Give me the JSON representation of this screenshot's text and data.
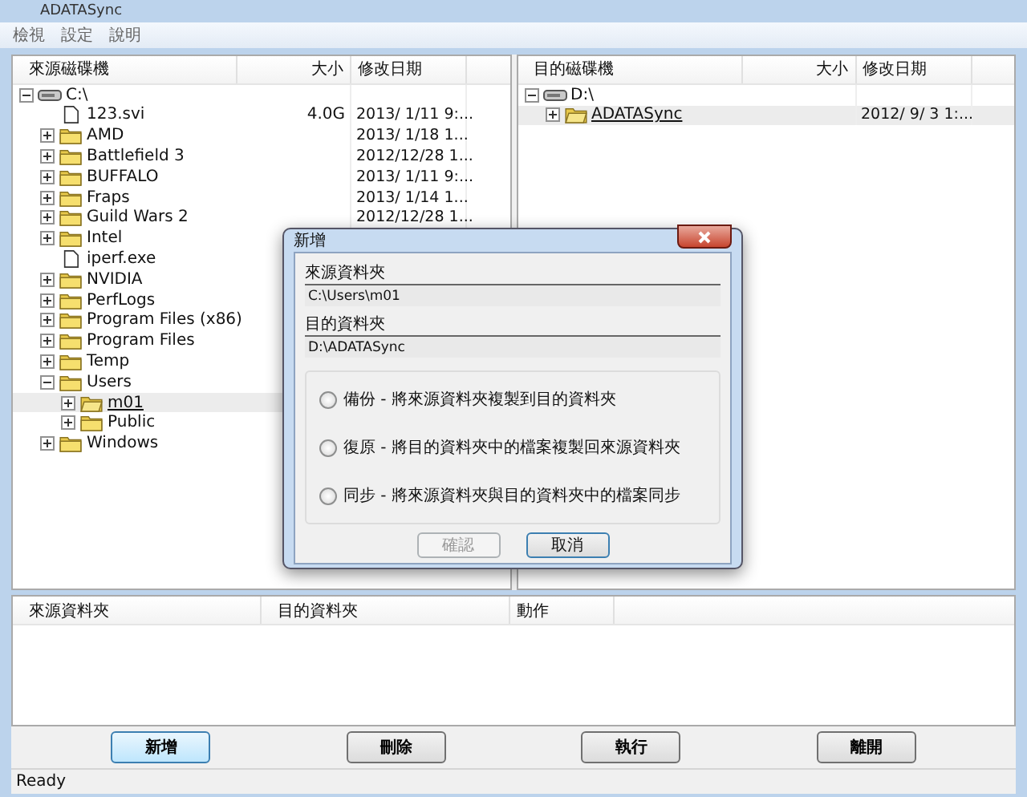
{
  "window": {
    "title": "ADATASync"
  },
  "menu": [
    "檢視",
    "設定",
    "說明"
  ],
  "left_pane": {
    "columns": [
      "來源磁碟機",
      "大小",
      "修改日期"
    ],
    "tree": [
      {
        "kind": "drive",
        "name": "C:\\",
        "expanded": true,
        "selected": false,
        "children": [
          {
            "kind": "file",
            "name": "123.svi",
            "size": "4.0G",
            "date": "2013/ 1/11 9:...",
            "selected": false
          },
          {
            "kind": "folder",
            "name": "AMD",
            "date": "2013/ 1/18 1...",
            "expanded": false,
            "selected": false
          },
          {
            "kind": "folder",
            "name": "Battlefield 3",
            "date": "2012/12/28 1...",
            "expanded": false,
            "selected": false
          },
          {
            "kind": "folder",
            "name": "BUFFALO",
            "date": "2013/ 1/11 9:...",
            "expanded": false,
            "selected": false
          },
          {
            "kind": "folder",
            "name": "Fraps",
            "date": "2013/ 1/14 1...",
            "expanded": false,
            "selected": false
          },
          {
            "kind": "folder",
            "name": "Guild Wars 2",
            "date": "2012/12/28 1...",
            "expanded": false,
            "selected": false
          },
          {
            "kind": "folder",
            "name": "Intel",
            "expanded": false,
            "selected": false
          },
          {
            "kind": "file",
            "name": "iperf.exe",
            "selected": false
          },
          {
            "kind": "folder",
            "name": "NVIDIA",
            "expanded": false,
            "selected": false
          },
          {
            "kind": "folder",
            "name": "PerfLogs",
            "expanded": false,
            "selected": false
          },
          {
            "kind": "folder",
            "name": "Program Files (x86)",
            "expanded": false,
            "selected": false
          },
          {
            "kind": "folder",
            "name": "Program Files",
            "expanded": false,
            "selected": false
          },
          {
            "kind": "folder",
            "name": "Temp",
            "expanded": false,
            "selected": false
          },
          {
            "kind": "folder",
            "name": "Users",
            "expanded": true,
            "selected": false,
            "children": [
              {
                "kind": "folder",
                "name": "m01",
                "expanded": false,
                "selected": true
              },
              {
                "kind": "folder",
                "name": "Public",
                "expanded": false,
                "selected": false
              }
            ]
          },
          {
            "kind": "folder",
            "name": "Windows",
            "expanded": false,
            "selected": false
          }
        ]
      }
    ]
  },
  "right_pane": {
    "columns": [
      "目的磁碟機",
      "大小",
      "修改日期"
    ],
    "tree": [
      {
        "kind": "drive",
        "name": "D:\\",
        "expanded": true,
        "selected": false,
        "children": [
          {
            "kind": "folder",
            "name": "ADATASync",
            "date": "2012/ 9/ 3 1:...",
            "expanded": false,
            "selected": true
          }
        ]
      }
    ]
  },
  "dialog": {
    "title": "新增",
    "source_label": "來源資料夾",
    "source_value": "C:\\Users\\m01",
    "dest_label": "目的資料夾",
    "dest_value": "D:\\ADATASync",
    "options": [
      {
        "label": "備份 - 將來源資料夾複製到目的資料夾",
        "selected": false
      },
      {
        "label": "復原 - 將目的資料夾中的檔案複製回來源資料夾",
        "selected": false
      },
      {
        "label": "同步 - 將來源資料夾與目的資料夾中的檔案同步",
        "selected": false
      }
    ],
    "buttons": [
      {
        "label": "確認",
        "disabled": true
      },
      {
        "label": "取消",
        "disabled": false
      }
    ]
  },
  "task_list": {
    "columns": [
      "來源資料夾",
      "目的資料夾",
      "動作"
    ]
  },
  "buttons": [
    {
      "label": "新增",
      "focused": true
    },
    {
      "label": "刪除",
      "focused": false
    },
    {
      "label": "執行",
      "focused": false
    },
    {
      "label": "離開",
      "focused": false
    }
  ],
  "status_bar": "Ready"
}
